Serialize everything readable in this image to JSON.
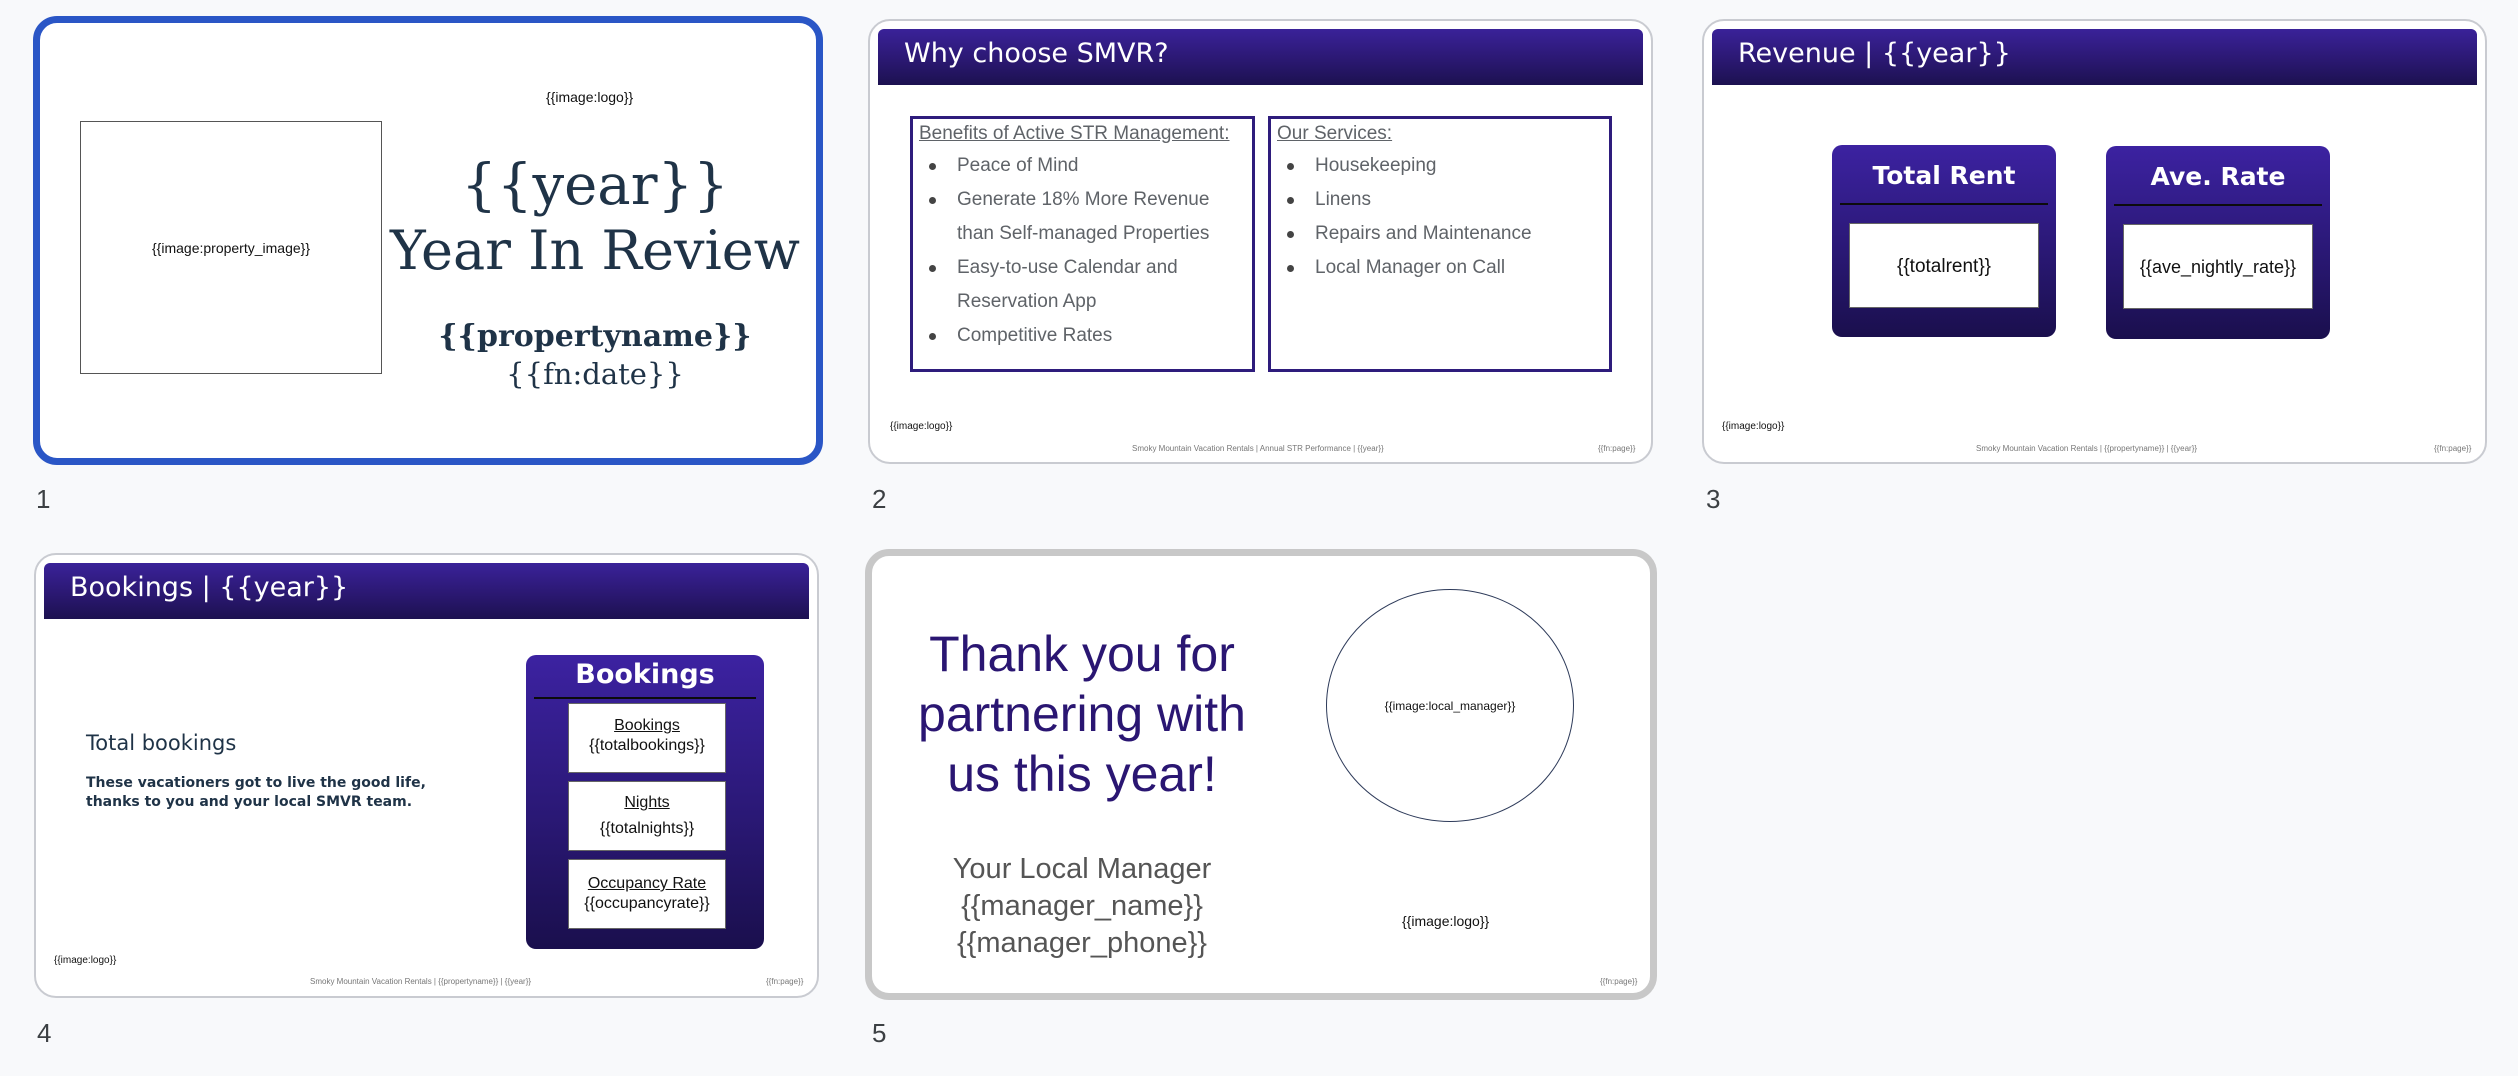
{
  "slides": [
    {
      "number": "1",
      "logo": "{{image:logo}}",
      "image_placeholder": "{{image:property_image}}",
      "year": "{{year}}",
      "subtitle": "Year In Review",
      "propertyname": "{{propertyname}}",
      "date": "{{fn:date}}"
    },
    {
      "number": "2",
      "title": "Why choose SMVR?",
      "benefits_title": "Benefits of Active STR Management:",
      "benefits": [
        "Peace of Mind",
        "Generate 18% More Revenue",
        "than Self-managed Properties",
        "Easy-to-use Calendar and",
        "Reservation App",
        "Competitive Rates"
      ],
      "services_title": "Our Services:",
      "services": [
        "Housekeeping",
        "Linens",
        "Repairs and Maintenance",
        "Local Manager on Call"
      ],
      "logo": "{{image:logo}}",
      "footer": "Smoky Mountain Vacation Rentals  |  Annual STR Performance | {{year}}",
      "page": "{{fn:page}}"
    },
    {
      "number": "3",
      "title": "Revenue  | {{year}}",
      "card1_title": "Total Rent",
      "card1_value": "{{totalrent}}",
      "card2_title": "Ave. Rate",
      "card2_value": "{{ave_nightly_rate}}",
      "logo": "{{image:logo}}",
      "footer": "Smoky Mountain Vacation Rentals  |  {{propertyname}} | {{year}}",
      "page": "{{fn:page}}"
    },
    {
      "number": "4",
      "title": "Bookings  | {{year}}",
      "heading": "Total bookings",
      "body_line1": "These vacationers got to live the good life,",
      "body_line2": "thanks to you and your local SMVR team.",
      "card_title": "Bookings",
      "rows": [
        {
          "label": "Bookings",
          "value": "{{totalbookings}}"
        },
        {
          "label": "Nights",
          "value": "{{totalnights}}"
        },
        {
          "label": "Occupancy Rate",
          "value": "{{occupancyrate}}"
        }
      ],
      "logo": "{{image:logo}}",
      "footer": "Smoky Mountain Vacation Rentals  |  {{propertyname}} | {{year}}",
      "page": "{{fn:page}}"
    },
    {
      "number": "5",
      "thanks_line1": "Thank you for",
      "thanks_line2": "partnering with",
      "thanks_line3": "us this year!",
      "manager_label": "Your Local Manager",
      "manager_name": "{{manager_name}}",
      "manager_phone": "{{manager_phone}}",
      "manager_image": "{{image:local_manager}}",
      "logo": "{{image:logo}}",
      "page": "{{fn:page}}"
    }
  ],
  "colors": {
    "accent_purple": "#2b1872",
    "selection_blue": "#2a56c6",
    "title_navy": "#1f3347"
  }
}
